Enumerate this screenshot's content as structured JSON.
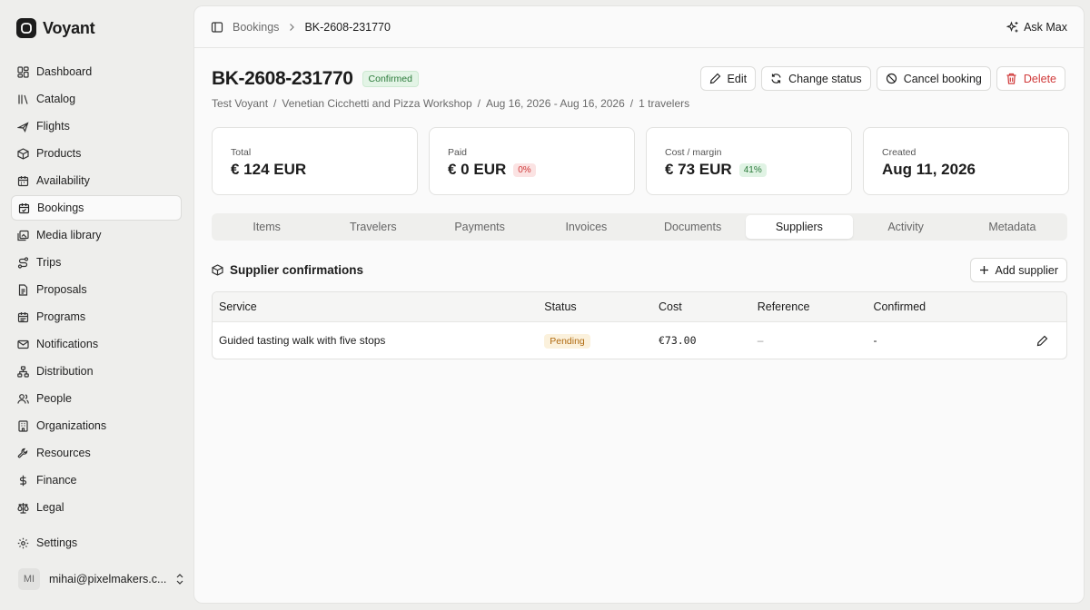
{
  "brand": {
    "name": "Voyant"
  },
  "sidebar": {
    "items": [
      {
        "label": "Dashboard",
        "icon": "dashboard-icon"
      },
      {
        "label": "Catalog",
        "icon": "library-icon"
      },
      {
        "label": "Flights",
        "icon": "plane-icon"
      },
      {
        "label": "Products",
        "icon": "package-icon"
      },
      {
        "label": "Availability",
        "icon": "calendar-icon"
      },
      {
        "label": "Bookings",
        "icon": "calendar-check-icon",
        "active": true
      },
      {
        "label": "Media library",
        "icon": "images-icon"
      },
      {
        "label": "Trips",
        "icon": "route-icon"
      },
      {
        "label": "Proposals",
        "icon": "file-text-icon"
      },
      {
        "label": "Programs",
        "icon": "calendar-range-icon"
      },
      {
        "label": "Notifications",
        "icon": "mail-icon"
      },
      {
        "label": "Distribution",
        "icon": "network-icon"
      },
      {
        "label": "People",
        "icon": "users-icon"
      },
      {
        "label": "Organizations",
        "icon": "building-icon"
      },
      {
        "label": "Resources",
        "icon": "wrench-icon"
      },
      {
        "label": "Finance",
        "icon": "dollar-icon"
      },
      {
        "label": "Legal",
        "icon": "scale-icon"
      }
    ],
    "settings_label": "Settings",
    "user": {
      "initials": "MI",
      "email": "mihai@pixelmakers.c..."
    }
  },
  "topbar": {
    "breadcrumb_parent": "Bookings",
    "breadcrumb_current": "BK-2608-231770",
    "ask_label": "Ask Max"
  },
  "booking": {
    "code": "BK-2608-231770",
    "status": "Confirmed",
    "meta": {
      "org": "Test Voyant",
      "product": "Venetian Cicchetti and Pizza Workshop",
      "dates": "Aug 16, 2026 - Aug 16, 2026",
      "travelers": "1 travelers"
    }
  },
  "actions": {
    "edit": "Edit",
    "change_status": "Change status",
    "cancel": "Cancel booking",
    "delete": "Delete"
  },
  "stats": {
    "total": {
      "label": "Total",
      "value": "€ 124 EUR"
    },
    "paid": {
      "label": "Paid",
      "value": "€ 0 EUR",
      "pill": "0%"
    },
    "cost": {
      "label": "Cost / margin",
      "value": "€ 73 EUR",
      "pill": "41%"
    },
    "created": {
      "label": "Created",
      "value": "Aug 11, 2026"
    }
  },
  "tabs": [
    "Items",
    "Travelers",
    "Payments",
    "Invoices",
    "Documents",
    "Suppliers",
    "Activity",
    "Metadata"
  ],
  "active_tab": "Suppliers",
  "suppliers": {
    "title": "Supplier confirmations",
    "add_label": "Add supplier",
    "columns": [
      "Service",
      "Status",
      "Cost",
      "Reference",
      "Confirmed"
    ],
    "rows": [
      {
        "service": "Guided tasting walk with five stops",
        "status": "Pending",
        "cost": "€73.00",
        "reference": "–",
        "confirmed": "-"
      }
    ]
  },
  "colors": {
    "confirmed": "#2b7a3a",
    "danger": "#d03a3a",
    "pending": "#b06a10"
  }
}
